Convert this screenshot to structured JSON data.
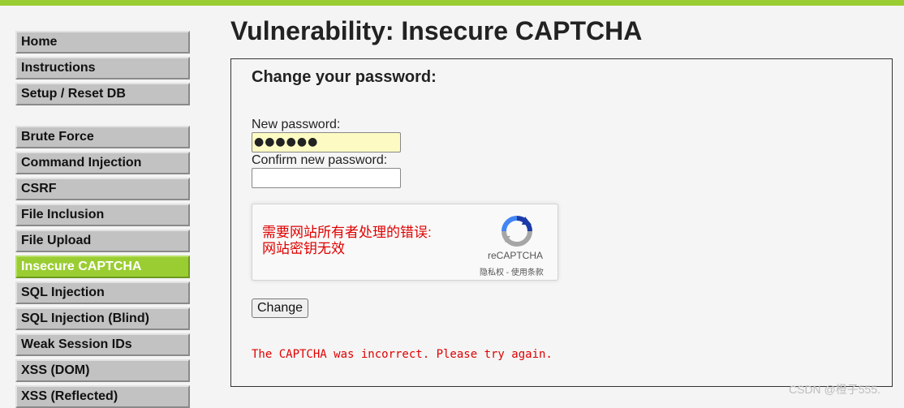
{
  "sidebar": {
    "items": [
      {
        "label": "Home"
      },
      {
        "label": "Instructions"
      },
      {
        "label": "Setup / Reset DB"
      },
      {
        "label": "Brute Force"
      },
      {
        "label": "Command Injection"
      },
      {
        "label": "CSRF"
      },
      {
        "label": "File Inclusion"
      },
      {
        "label": "File Upload"
      },
      {
        "label": "Insecure CAPTCHA",
        "selected": true
      },
      {
        "label": "SQL Injection"
      },
      {
        "label": "SQL Injection (Blind)"
      },
      {
        "label": "Weak Session IDs"
      },
      {
        "label": "XSS (DOM)"
      },
      {
        "label": "XSS (Reflected)"
      }
    ]
  },
  "main": {
    "title": "Vulnerability: Insecure CAPTCHA",
    "form": {
      "heading": "Change your password:",
      "new_password_label": "New password:",
      "new_password_value": "●●●●●●",
      "confirm_password_label": "Confirm new password:",
      "confirm_password_value": "",
      "submit_label": "Change"
    },
    "recaptcha": {
      "error_line1": "需要网站所有者处理的错误:",
      "error_line2": "网站密钥无效",
      "brand": "reCAPTCHA",
      "links": "隐私权 - 使用条款"
    },
    "error_message": "The CAPTCHA was incorrect. Please try again."
  },
  "watermark": "CSDN @橙子555.",
  "colors": {
    "accent": "#9acd32",
    "error": "#e00000",
    "autofill": "#fdfbc3"
  }
}
